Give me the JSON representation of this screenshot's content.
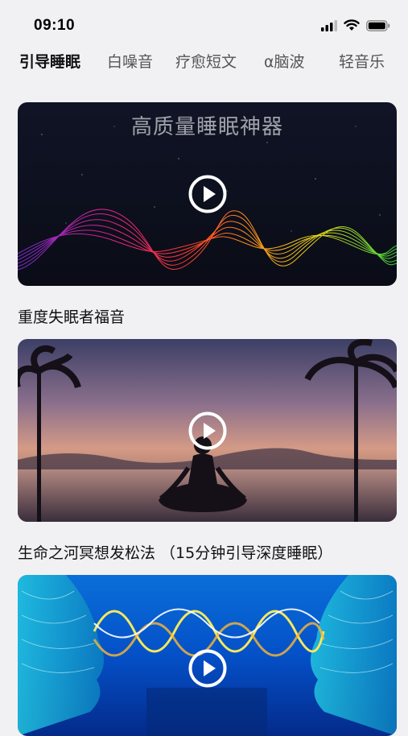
{
  "status_bar": {
    "time": "09:10"
  },
  "tabs": [
    {
      "label": "引导睡眠",
      "active": true
    },
    {
      "label": "白噪音",
      "active": false
    },
    {
      "label": "疗愈短文",
      "active": false
    },
    {
      "label": "α脑波",
      "active": false
    },
    {
      "label": "轻音乐",
      "active": false
    }
  ],
  "cards": [
    {
      "overlay_title": "高质量睡眠神器",
      "caption": "重度失眠者福音"
    },
    {
      "overlay_title": "",
      "caption": "生命之河冥想发松法 （15分钟引导深度睡眠）"
    },
    {
      "overlay_title": "",
      "caption": ""
    }
  ],
  "colors": {
    "background": "#f1f1f3",
    "active_tab": "#111111",
    "inactive_tab": "#555555"
  }
}
